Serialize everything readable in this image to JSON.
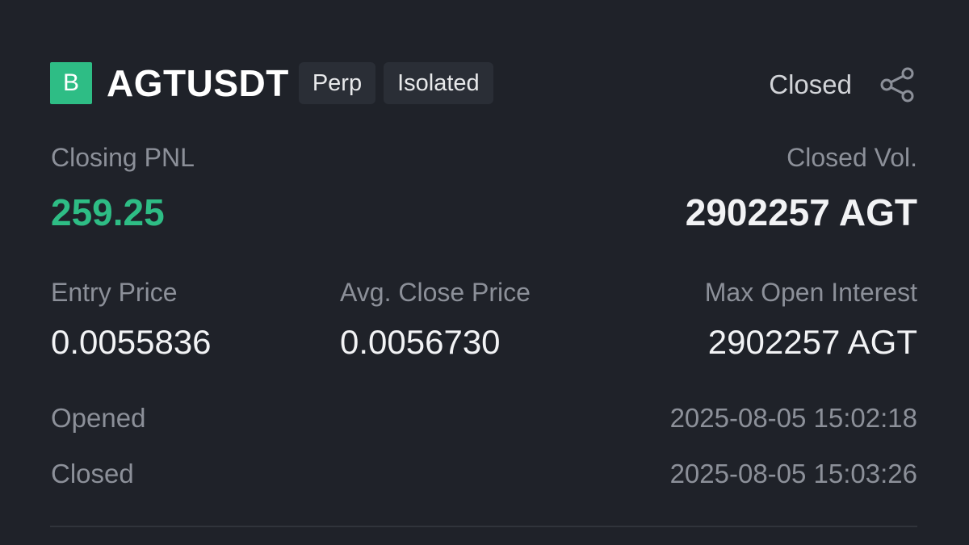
{
  "header": {
    "logo_letter": "B",
    "symbol": "AGTUSDT",
    "tags": [
      "Perp",
      "Isolated"
    ],
    "status": "Closed",
    "share_icon": "share-icon"
  },
  "pnl": {
    "label": "Closing PNL",
    "value": "259.25"
  },
  "volume": {
    "label": "Closed Vol.",
    "value": "2902257 AGT"
  },
  "stats": {
    "entry_label": "Entry Price",
    "entry_value": "0.0055836",
    "close_label": "Avg. Close Price",
    "close_value": "0.0056730",
    "oi_label": "Max Open Interest",
    "oi_value": "2902257 AGT"
  },
  "times": {
    "opened_label": "Opened",
    "opened_value": "2025-08-05 15:02:18",
    "closed_label": "Closed",
    "closed_value": "2025-08-05 15:03:26"
  },
  "colors": {
    "background": "#1f2229",
    "accent_green": "#2ebd85",
    "tag_bg": "#2a2e36"
  }
}
